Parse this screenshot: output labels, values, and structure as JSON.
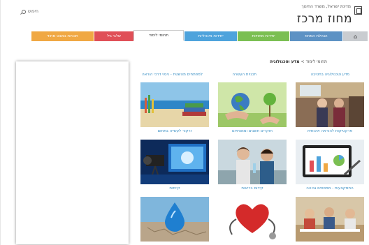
{
  "header": {
    "ministry": "מדינת ישראל, משרד החינוך",
    "site_title": "מחוז מרכז",
    "search_label": "חיפוש",
    "emblem_icon": "menorah-emblem-icon"
  },
  "nav": {
    "home_icon": "home-icon",
    "items": [
      {
        "label": "הנהלת המחוז",
        "color": "#5d92c4"
      },
      {
        "label": "יחידות מחוזיות",
        "color": "#7bbf52"
      },
      {
        "label": "יחידות מינהליות",
        "color": "#4ea3dc"
      },
      {
        "label": "תחומי לימוד",
        "color": "#ffffff"
      },
      {
        "label": "שלבי גיל",
        "color": "#e04f57"
      },
      {
        "label": "תכניות במבט מחוזי",
        "color": "#f0a843"
      }
    ]
  },
  "breadcrumb": {
    "parent": "תחומי לימוד",
    "separator": ">",
    "current": "מדע וטכנולוגיה"
  },
  "categories": [
    "מדע וטכנולוגיה בחטיבה",
    "תכניות העשרה",
    "למפתחים מהשטח - ניסוי דרכי הוראה"
  ],
  "tiles": [
    {
      "caption": "פרקטיקות להוראה איכותית",
      "icon": "teachers-photo-icon"
    },
    {
      "caption": "חוקרים חשבים וממציאים",
      "icon": "earth-in-hands-photo-icon"
    },
    {
      "caption": "זרקור לעשייה בתחום",
      "icon": "beach-desk-photo-icon"
    },
    {
      "caption": "התמקצעות - ממפסים גבוהה",
      "icon": "tablet-charts-photo-icon"
    },
    {
      "caption": "קידום בריאות",
      "icon": "students-lab-photo-icon"
    },
    {
      "caption": "קיימות",
      "icon": "studio-camera-photo-icon"
    },
    {
      "caption": "",
      "icon": "students-class-photo-icon"
    },
    {
      "caption": "",
      "icon": "heart-stethoscope-photo-icon"
    },
    {
      "caption": "",
      "icon": "water-drop-photo-icon"
    }
  ]
}
